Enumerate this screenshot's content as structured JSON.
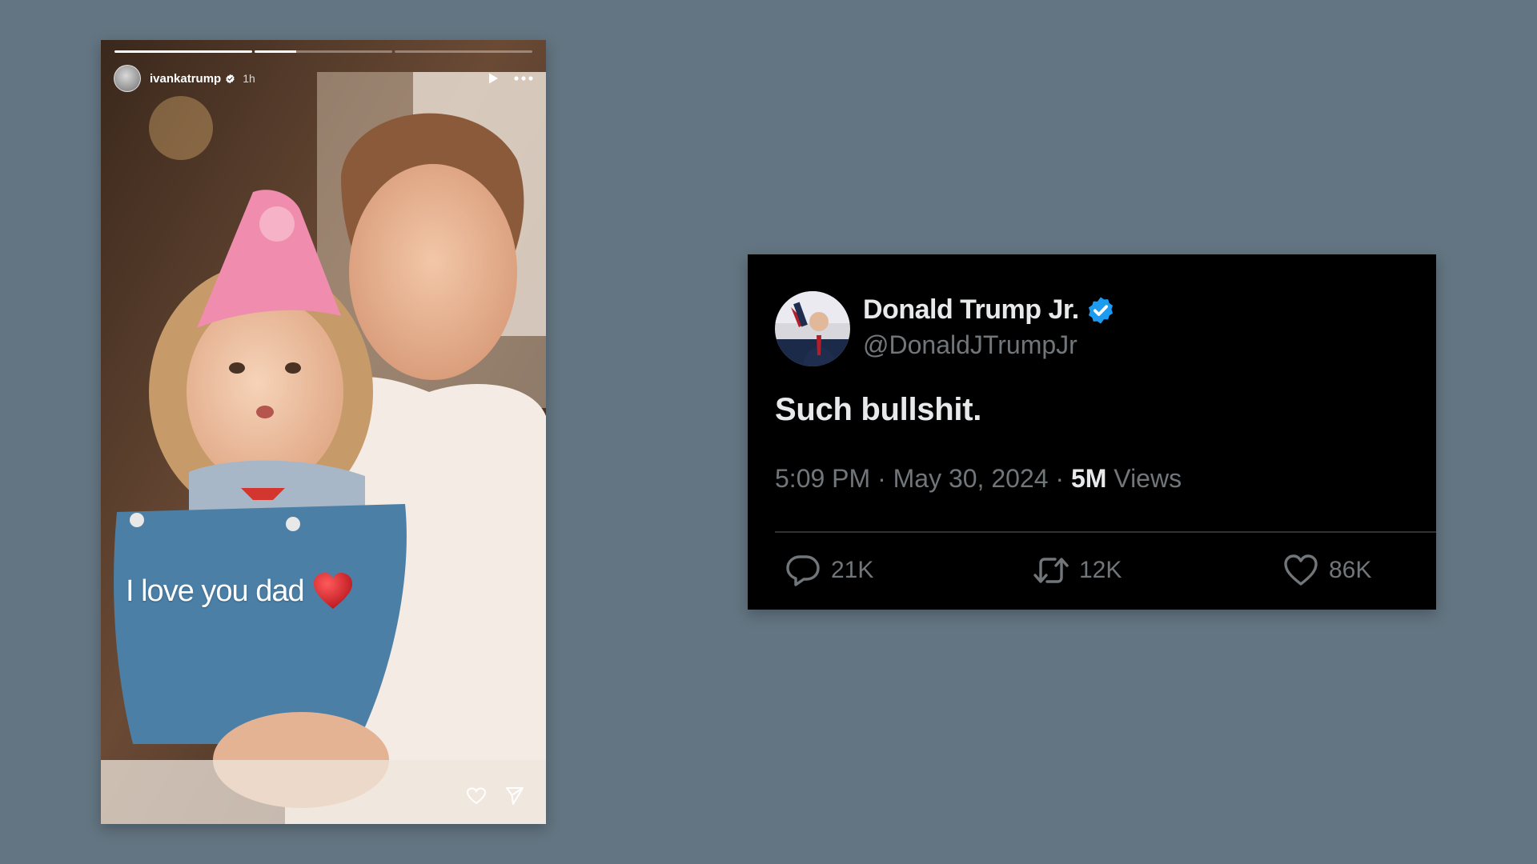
{
  "story": {
    "username": "ivankatrump",
    "time_ago": "1h",
    "caption": "I love you dad",
    "progress": [
      1.0,
      0.3,
      0.0
    ],
    "icons": {
      "avatar": "profile-avatar",
      "verified": "verified-badge-icon",
      "play": "play-icon",
      "more": "more-horizontal-icon",
      "caption_emoji": "red-heart-emoji",
      "like": "heart-outline-icon",
      "share": "send-icon"
    }
  },
  "tweet": {
    "display_name": "Donald Trump Jr.",
    "handle": "@DonaldJTrumpJr",
    "text": "Such bullshit.",
    "timestamp": "5:09 PM · May 30, 2024 · ",
    "views_count": "5M",
    "views_label": " Views",
    "replies": "21K",
    "retweets": "12K",
    "likes": "86K",
    "colors": {
      "background": "#000000",
      "text": "#e7e9ea",
      "secondary": "#71767b",
      "verified": "#1d9bf0"
    }
  }
}
